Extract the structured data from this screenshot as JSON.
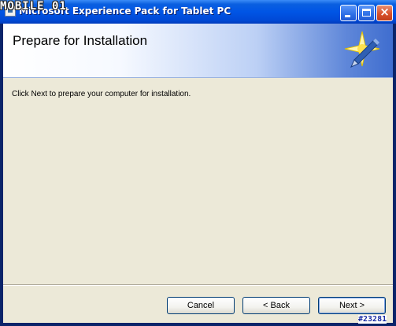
{
  "window": {
    "title": "Microsoft Experience Pack for Tablet PC",
    "controls": {
      "minimize": "minimize",
      "maximize": "maximize",
      "close": "×"
    }
  },
  "banner": {
    "title": "Prepare for Installation",
    "icon": "tablet-pen-star-icon"
  },
  "main": {
    "instruction": "Click Next to prepare your computer for installation."
  },
  "buttons": {
    "cancel": "Cancel",
    "back": "< Back",
    "next": "Next >"
  },
  "overlay": {
    "watermark": "MOBILE 01",
    "badge": "#23281"
  }
}
